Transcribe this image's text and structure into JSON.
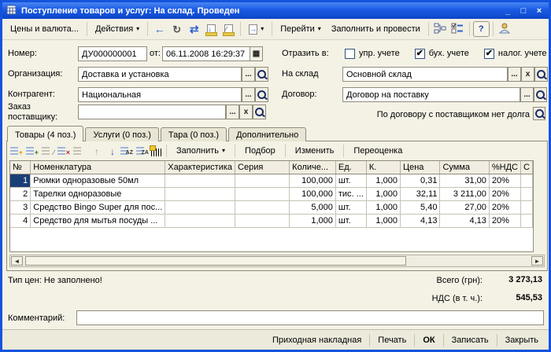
{
  "window": {
    "title": "Поступление товаров и услуг: На склад. Проведен",
    "controls": {
      "minimize": "_",
      "maximize": "□",
      "close": "×"
    }
  },
  "icons": {
    "dropdown": "▾",
    "calendar": "▦",
    "check": "✔",
    "clear": "x",
    "ellipsis": "...",
    "back": "←",
    "renumber": "↻",
    "swap": "⇄",
    "post": "↓",
    "unpost": "∕",
    "goto": "→",
    "help": "?",
    "scroll_left": "◄",
    "scroll_right": "►",
    "add": "+",
    "copy": "+",
    "edit": "∕",
    "delete": "×",
    "up": "↑",
    "down": "↓",
    "sort_az": "AZ",
    "sort_za": "ZA"
  },
  "toolbar": {
    "prices": "Цены и валюта...",
    "actions": "Действия",
    "goto": "Перейти",
    "fill_post": "Заполнить и провести"
  },
  "form": {
    "number": {
      "label": "Номер:",
      "value": "ДУ000000001"
    },
    "date": {
      "label": "от:",
      "value": "06.11.2008 16:29:37"
    },
    "reflect": {
      "label": "Отразить в:",
      "checkboxes": [
        {
          "label": "упр. учете",
          "checked": false
        },
        {
          "label": "бух. учете",
          "checked": true
        },
        {
          "label": "налог. учете",
          "checked": true
        }
      ]
    },
    "organization": {
      "label": "Организация:",
      "value": "Доставка и установка"
    },
    "warehouse": {
      "label": "На склад",
      "value": "Основной склад"
    },
    "contractor": {
      "label": "Контрагент:",
      "value": "Национальная"
    },
    "contract": {
      "label": "Договор:",
      "value": "Договор на поставку"
    },
    "supplier_order": {
      "label": "Заказ поставщику:",
      "value": ""
    },
    "debt_note": "По договору с поставщиком нет долга"
  },
  "tabs": [
    {
      "label": "Товары (4 поз.)",
      "active": true
    },
    {
      "label": "Услуги (0 поз.)",
      "active": false
    },
    {
      "label": "Тара (0 поз.)",
      "active": false
    },
    {
      "label": "Дополнительно",
      "active": false
    }
  ],
  "items_toolbar": {
    "fill": "Заполнить",
    "pick": "Подбор",
    "edit": "Изменить",
    "reprice": "Переоценка"
  },
  "table": {
    "headers": [
      "№",
      "Номенклатура",
      "Характеристика",
      "Серия",
      "Количе...",
      "Ед.",
      "К.",
      "Цена",
      "Сумма",
      "%НДС",
      "С"
    ],
    "rows": [
      [
        "1",
        "Рюмки одноразовые 50мл",
        "",
        "",
        "100,000",
        "шт.",
        "1,000",
        "0,31",
        "31,00",
        "20%",
        ""
      ],
      [
        "2",
        "Тарелки одноразовые",
        "",
        "",
        "100,000",
        "тис. ...",
        "1,000",
        "32,11",
        "3 211,00",
        "20%",
        ""
      ],
      [
        "3",
        "Средство Bingo Super для пос...",
        "",
        "",
        "5,000",
        "шт.",
        "1,000",
        "5,40",
        "27,00",
        "20%",
        ""
      ],
      [
        "4",
        "Средство для мытья посуды ...",
        "",
        "",
        "1,000",
        "шт.",
        "1,000",
        "4,13",
        "4,13",
        "20%",
        ""
      ]
    ],
    "selected_row": 1
  },
  "totals": {
    "price_type_warning": "Тип цен: Не заполнено!",
    "total_label": "Всего (грн):",
    "total_value": "3 273,13",
    "vat_label": "НДС (в т. ч.):",
    "vat_value": "545,53"
  },
  "comment": {
    "label": "Комментарий:",
    "value": ""
  },
  "footer": {
    "buttons": [
      {
        "label": "Приходная накладная",
        "bold": false
      },
      {
        "label": "Печать",
        "bold": false
      },
      {
        "label": "ОК",
        "bold": true
      },
      {
        "label": "Записать",
        "bold": false
      },
      {
        "label": "Закрыть",
        "bold": false
      }
    ]
  }
}
